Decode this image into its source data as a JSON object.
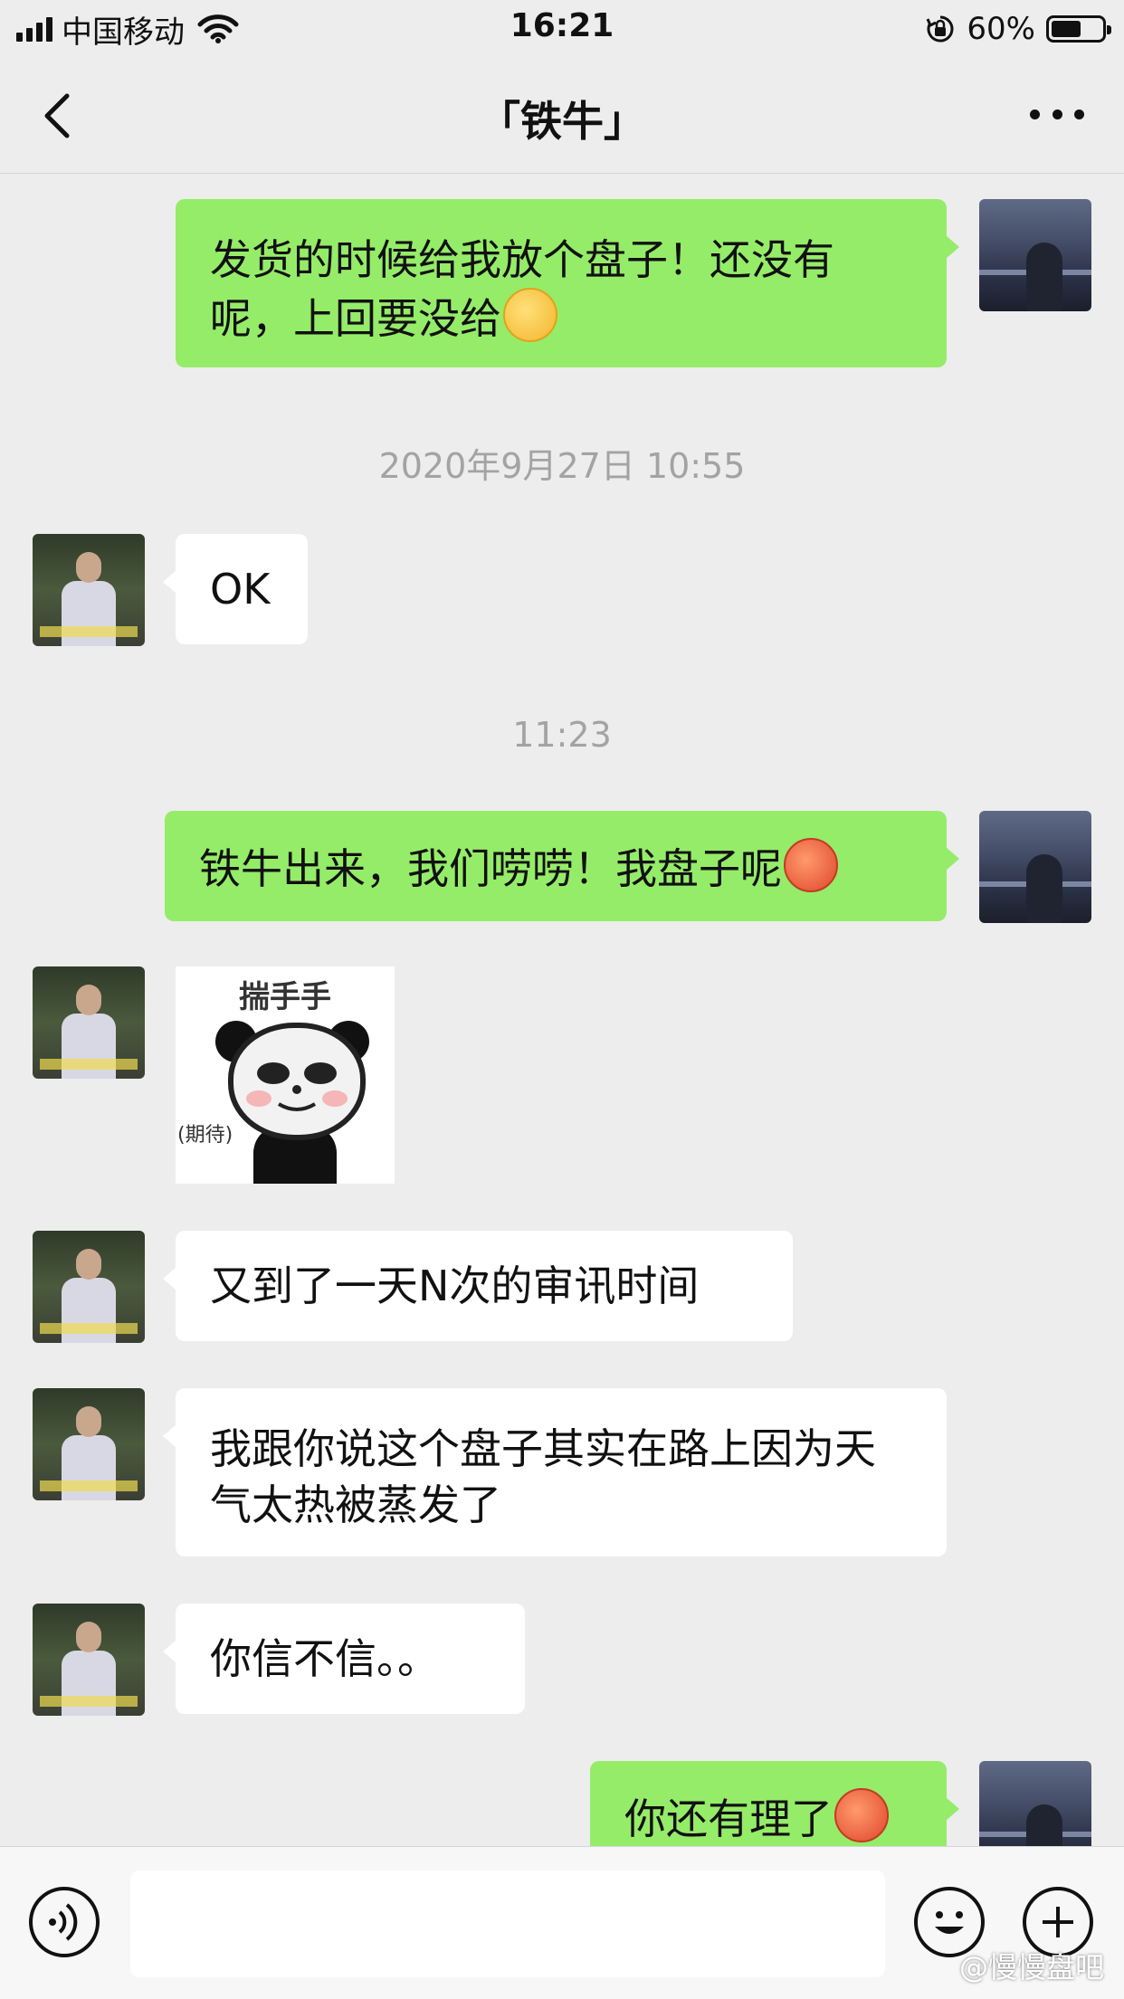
{
  "status_bar": {
    "carrier": "中国移动",
    "time": "16:21",
    "battery_percent": "60%",
    "battery_level": 0.6
  },
  "nav": {
    "title": "「铁牛」",
    "back_icon": "chevron-left-icon",
    "more_icon": "more-dots-icon"
  },
  "messages": [
    {
      "from": "me",
      "text": "发货的时候给我放个盘子！还没有呢，上回要没给",
      "emoji": "laughing-crying-emoji"
    },
    {
      "timestamp": "2020年9月27日 10:55"
    },
    {
      "from": "them",
      "text": "OK"
    },
    {
      "timestamp": "11:23"
    },
    {
      "from": "me",
      "text": "铁牛出来，我们唠唠！我盘子呢",
      "emoji": "angry-emoji"
    },
    {
      "from": "them",
      "sticker_text": "揣手手",
      "sticker_sub": "(期待)"
    },
    {
      "from": "them",
      "text": "又到了一天N次的审讯时间"
    },
    {
      "from": "them",
      "text": "我跟你说这个盘子其实在路上因为天气太热被蒸发了"
    },
    {
      "from": "them",
      "text": "你信不信。。"
    },
    {
      "from": "me",
      "text": "你还有理了",
      "emoji": "angry-emoji"
    }
  ],
  "input_bar": {
    "voice_icon": "voice-icon",
    "emoji_icon": "emoji-icon",
    "plus_icon": "plus-icon",
    "watermark": "@慢慢盘吧"
  },
  "colors": {
    "background": "#ededed",
    "my_bubble": "#95ec69",
    "their_bubble": "#ffffff",
    "timestamp_text": "#a3a3a3"
  }
}
